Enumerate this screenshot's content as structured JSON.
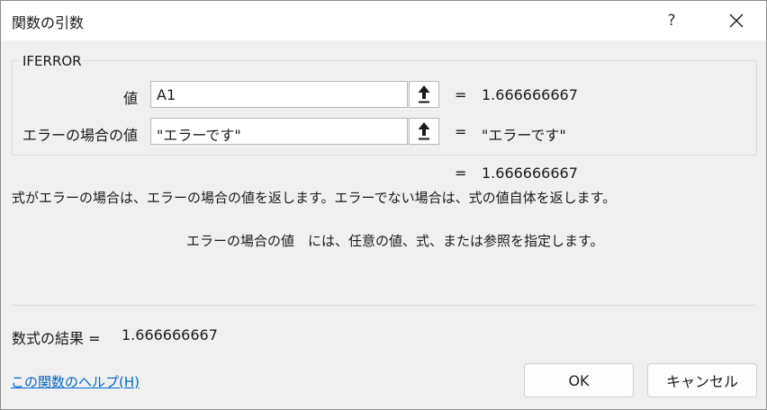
{
  "window": {
    "title": "関数の引数",
    "help_glyph": "?"
  },
  "function": {
    "name": "IFERROR",
    "arguments": [
      {
        "label": "値",
        "input_value": "A1",
        "result": "1.666666667"
      },
      {
        "label": "エラーの場合の値",
        "input_value": "\"エラーです\"",
        "result": "\"エラーです\""
      }
    ],
    "equals": "=",
    "formula_result": "1.666666667",
    "description": "式がエラーの場合は、エラーの場合の値を返します。エラーでない場合は、式の値自体を返します。",
    "argument_description": "エラーの場合の値　には、任意の値、式、または参照を指定します。"
  },
  "result": {
    "label": "数式の結果 =",
    "value": "1.666666667"
  },
  "footer": {
    "help_link": "この関数のヘルプ(H)",
    "ok_label": "OK",
    "cancel_label": "キャンセル"
  },
  "icons": {
    "close": "close-icon",
    "reference": "arrow-up-icon"
  },
  "colors": {
    "link": "#0066cc",
    "titlebar": "#ffffff",
    "background": "#f0f0f0"
  }
}
